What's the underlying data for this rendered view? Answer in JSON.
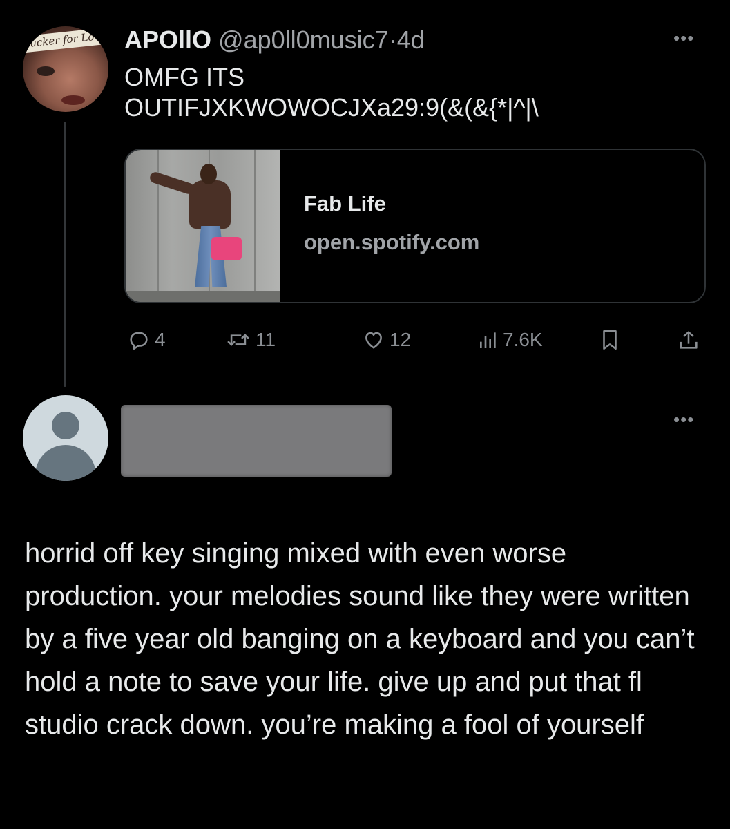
{
  "tweet": {
    "display_name": "APOllO",
    "handle": "@ap0ll0music7",
    "separator": "·",
    "time": "4d",
    "more_icon": "more-dots-icon",
    "text": "OMFG ITS\nOUTIFJXKWOWOCJXa29:9(&(&{*|^|\\",
    "avatar_text": "ucker for Love",
    "card": {
      "title": "Fab Life",
      "domain": "open.spotify.com"
    },
    "actions": {
      "replies": "4",
      "retweets": "11",
      "likes": "12",
      "views": "7.6K"
    }
  },
  "reply": {
    "text": "horrid off key singing mixed with even worse production. your melodies sound like they were written by a five year old banging on a keyboard and you can’t hold a note to save your life. give up and put that fl studio crack down. you’re making a fool of yourself"
  },
  "colors": {
    "background": "#000000",
    "text": "#e7e9ea",
    "muted": "#8b8f94",
    "border": "#2f3336"
  }
}
